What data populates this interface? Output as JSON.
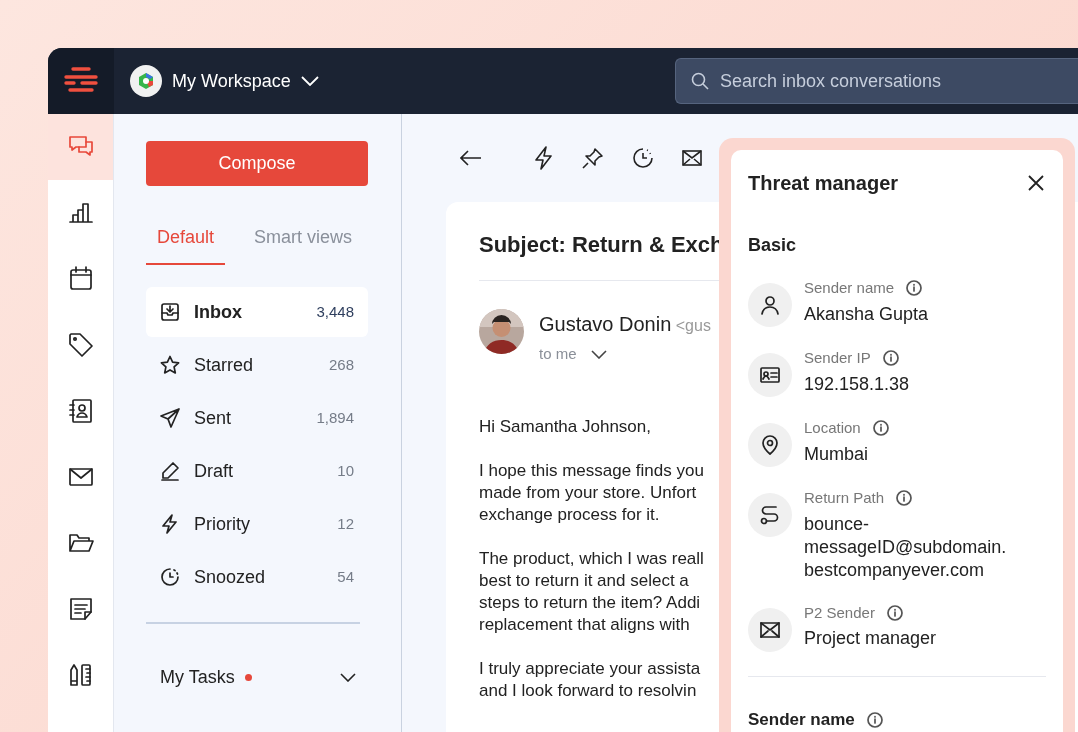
{
  "topbar": {
    "workspace": "My Workspace",
    "search": {
      "placeholder": "Search inbox conversations"
    }
  },
  "rail": [
    {
      "selected": true
    },
    {
      "selected": false
    },
    {
      "selected": false
    },
    {
      "selected": false
    },
    {
      "selected": false
    },
    {
      "selected": false
    },
    {
      "selected": false
    },
    {
      "selected": false
    },
    {
      "selected": false
    }
  ],
  "sidebar": {
    "compose": "Compose",
    "tabs": [
      {
        "label": "Default",
        "selected": true
      },
      {
        "label": "Smart views",
        "selected": false
      }
    ],
    "folders": [
      {
        "label": "Inbox",
        "count": "3,448",
        "selected": true
      },
      {
        "label": "Starred",
        "count": "268",
        "selected": false
      },
      {
        "label": "Sent",
        "count": "1,894",
        "selected": false
      },
      {
        "label": "Draft",
        "count": "10",
        "selected": false
      },
      {
        "label": "Priority",
        "count": "12",
        "selected": false
      },
      {
        "label": "Snoozed",
        "count": "54",
        "selected": false
      }
    ],
    "tasks": {
      "label": "My Tasks",
      "unread": true
    }
  },
  "email": {
    "subject": "Subject: Return & Exch",
    "sender": "Gustavo Donin",
    "address": "<gus",
    "recipient": "to me",
    "paragraphs": [
      [
        "Hi Samantha Johnson,"
      ],
      [
        "I hope this message finds you",
        "made from your store. Unfort",
        "exchange process for it."
      ],
      [
        "The product, which I was reall",
        "best to return it and select a",
        "steps to return the item? Addi",
        "replacement that aligns with"
      ],
      [
        "I truly appreciate your assista",
        "and I look forward to resolvin"
      ]
    ]
  },
  "threat_manager": {
    "title": "Threat manager",
    "section": "Basic",
    "fields": [
      {
        "label": "Sender name",
        "value": "Akansha Gupta"
      },
      {
        "label": "Sender IP",
        "value": "192.158.1.38"
      },
      {
        "label": "Location",
        "value": "Mumbai"
      },
      {
        "label": "Return Path",
        "value": "bounce-messageID@subdomain.bestcompanyever.com"
      },
      {
        "label": "P2 Sender",
        "value": "Project manager"
      }
    ],
    "next_section": "Sender name"
  }
}
